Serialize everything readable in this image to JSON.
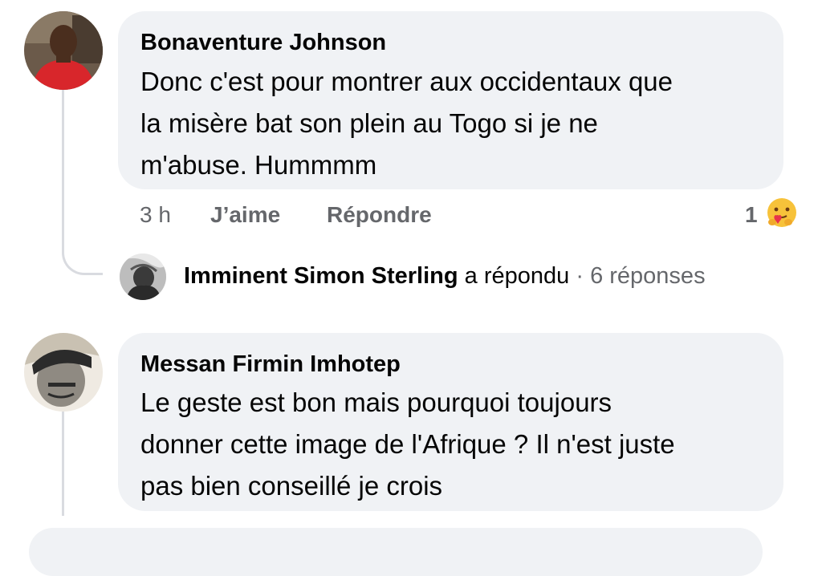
{
  "comments": [
    {
      "author": "Bonaventure Johnson",
      "text": "Donc c'est pour montrer aux occidentaux que\nla misère bat son plein au Togo si je ne\nm'abuse. Hummmm",
      "time": "3 h",
      "like_label": "J’aime",
      "reply_label": "Répondre",
      "reaction_count": "1",
      "reaction_icon": "care-emoji-icon",
      "reply_summary": {
        "name": "Imminent Simon Sterling",
        "action": "a répondu",
        "separator": "·",
        "count": "6 réponses"
      }
    },
    {
      "author": "Messan Firmin Imhotep",
      "text": "Le geste est bon mais pourquoi toujours\ndonner cette image de l'Afrique ? Il n'est juste\npas bien conseillé je crois"
    }
  ],
  "colors": {
    "bubble": "#f0f2f5",
    "secondary_text": "#65676b",
    "primary_text": "#050505",
    "thread_line": "#d9dbe0"
  }
}
